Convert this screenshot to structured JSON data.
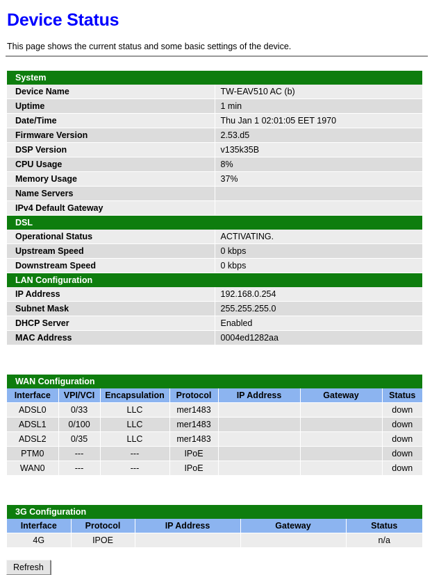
{
  "header": {
    "title": "Device Status",
    "description": "This page shows the current status and some basic settings of the device."
  },
  "colors": {
    "title": "#0000ff",
    "section_header_green": "#0e7d0e",
    "table_header_blue": "#8cb4f0",
    "row_light": "#ececec",
    "row_dark": "#dcdcdc"
  },
  "sections": {
    "system": {
      "heading": "System",
      "rows": [
        {
          "label": "Device Name",
          "value": "TW-EAV510 AC (b)"
        },
        {
          "label": "Uptime",
          "value": "1 min"
        },
        {
          "label": "Date/Time",
          "value": "Thu Jan 1 02:01:05 EET 1970"
        },
        {
          "label": "Firmware Version",
          "value": "2.53.d5"
        },
        {
          "label": "DSP Version",
          "value": "v135k35B"
        },
        {
          "label": "CPU Usage",
          "value": "8%"
        },
        {
          "label": "Memory Usage",
          "value": "37%"
        },
        {
          "label": "Name Servers",
          "value": ""
        },
        {
          "label": "IPv4 Default Gateway",
          "value": ""
        }
      ]
    },
    "dsl": {
      "heading": "DSL",
      "rows": [
        {
          "label": "Operational Status",
          "value": "ACTIVATING."
        },
        {
          "label": "Upstream Speed",
          "value": "0 kbps"
        },
        {
          "label": "Downstream Speed",
          "value": "0 kbps"
        }
      ]
    },
    "lan": {
      "heading": "LAN Configuration",
      "rows": [
        {
          "label": "IP Address",
          "value": "192.168.0.254"
        },
        {
          "label": "Subnet Mask",
          "value": "255.255.255.0"
        },
        {
          "label": "DHCP Server",
          "value": "Enabled"
        },
        {
          "label": "MAC Address",
          "value": "0004ed1282aa"
        }
      ]
    },
    "wan": {
      "heading": "WAN Configuration",
      "columns": [
        "Interface",
        "VPI/VCI",
        "Encapsulation",
        "Protocol",
        "IP Address",
        "Gateway",
        "Status"
      ],
      "rows": [
        [
          "ADSL0",
          "0/33",
          "LLC",
          "mer1483",
          "",
          "",
          "down"
        ],
        [
          "ADSL1",
          "0/100",
          "LLC",
          "mer1483",
          "",
          "",
          "down"
        ],
        [
          "ADSL2",
          "0/35",
          "LLC",
          "mer1483",
          "",
          "",
          "down"
        ],
        [
          "PTM0",
          "---",
          "---",
          "IPoE",
          "",
          "",
          "down"
        ],
        [
          "WAN0",
          "---",
          "---",
          "IPoE",
          "",
          "",
          "down"
        ]
      ]
    },
    "threeg": {
      "heading": "3G Configuration",
      "columns": [
        "Interface",
        "Protocol",
        "IP Address",
        "Gateway",
        "Status"
      ],
      "rows": [
        [
          "4G",
          "IPOE",
          "",
          "",
          "n/a"
        ]
      ]
    }
  },
  "actions": {
    "refresh_label": "Refresh"
  }
}
